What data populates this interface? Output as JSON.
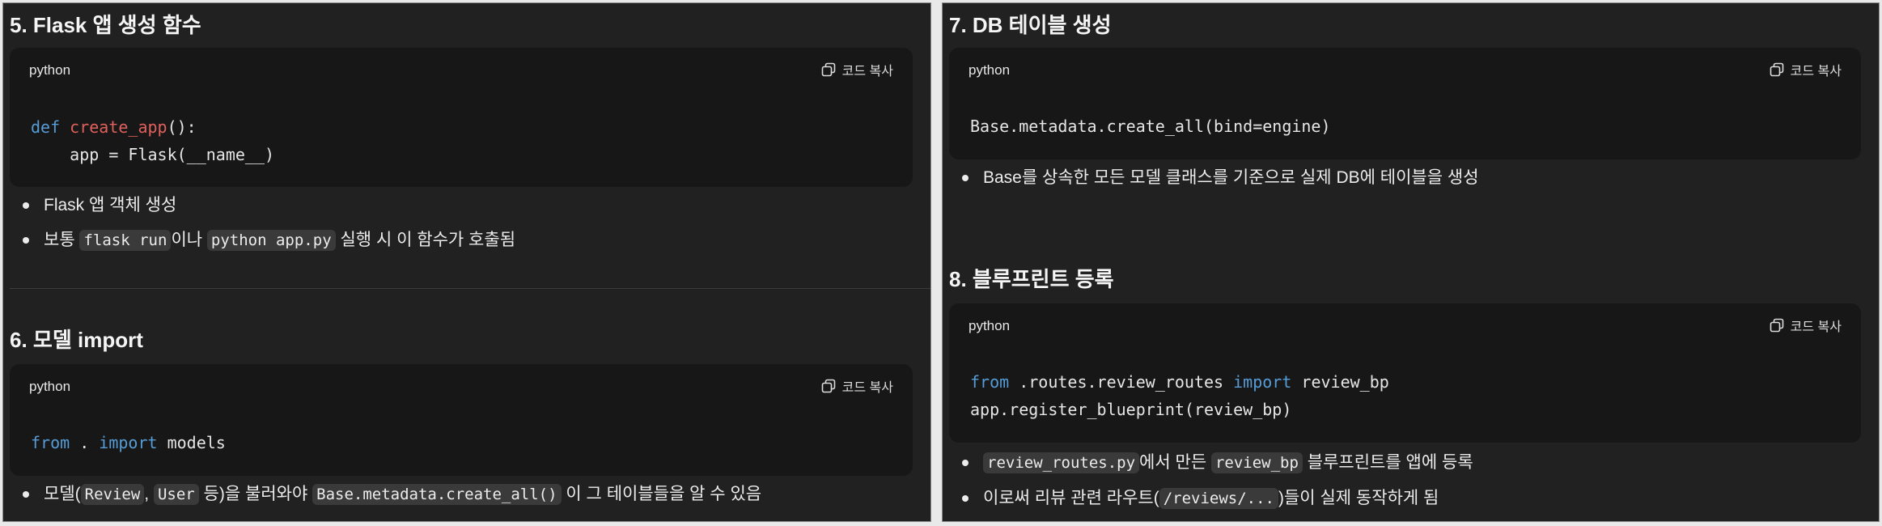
{
  "left": {
    "s5": {
      "heading": "5. Flask 앱 생성 함수",
      "lang": "python",
      "copy": "코드 복사",
      "code": {
        "l1_kw": "def",
        "l1_fn": "create_app",
        "l1_rest": "():",
        "l2": "    app = Flask(__name__)"
      },
      "bullet1": "Flask 앱 객체 생성",
      "bullet2": {
        "pre": "보통 ",
        "c1": "flask run",
        "mid": "이나 ",
        "c2": "python app.py",
        "post": " 실행 시 이 함수가 호출됨"
      }
    },
    "s6": {
      "heading": "6. 모델 import",
      "lang": "python",
      "copy": "코드 복사",
      "code": {
        "kw1": "from",
        "mid": " . ",
        "kw2": "import",
        "rest": " models"
      },
      "bullet1": {
        "pre": "모델(",
        "c1": "Review",
        "comma": ", ",
        "c2": "User",
        "mid": " 등)을 불러와야 ",
        "c3": "Base.metadata.create_all()",
        "post": " 이 그 테이블들을 알 수 있음"
      }
    }
  },
  "right": {
    "s7": {
      "heading": "7. DB 테이블 생성",
      "lang": "python",
      "copy": "코드 복사",
      "code": "Base.metadata.create_all(bind=engine)",
      "bullet1": "Base를 상속한 모든 모델 클래스를 기준으로 실제 DB에 테이블을 생성"
    },
    "s8": {
      "heading": "8. 블루프린트 등록",
      "lang": "python",
      "copy": "코드 복사",
      "code": {
        "kw1": "from",
        "mid": " .routes.review_routes ",
        "kw2": "import",
        "rest": " review_bp",
        "l2": "app.register_blueprint(review_bp)"
      },
      "bullet1": {
        "c1": "review_routes.py",
        "mid": "에서 만든 ",
        "c2": "review_bp",
        "post": " 블루프린트를 앱에 등록"
      },
      "bullet2": {
        "pre": "이로써 리뷰 관련 라우트(",
        "c1": "/reviews/...",
        "post": ")들이 실제 동작하게 됨"
      }
    }
  },
  "icons": {
    "copy": "copy-icon"
  }
}
